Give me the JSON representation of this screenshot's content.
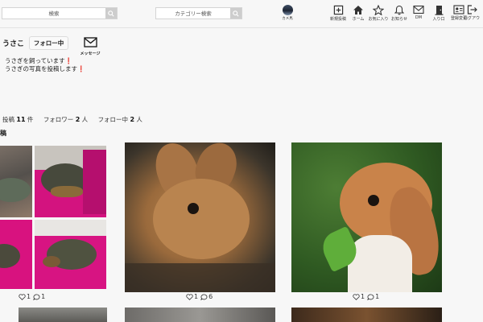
{
  "header": {
    "search_placeholder": "検索",
    "category_placeholder": "カテゴリー検索",
    "logo_text": "カメ馬",
    "nav": [
      {
        "label": "新規投稿",
        "icon": "plus-square-icon"
      },
      {
        "label": "ホーム",
        "icon": "home-icon"
      },
      {
        "label": "お気に入り",
        "icon": "star-icon"
      },
      {
        "label": "お知らせ",
        "icon": "bell-icon"
      },
      {
        "label": "DM",
        "icon": "mail-icon"
      },
      {
        "label": "入り口",
        "icon": "door-icon"
      },
      {
        "label": "登録変更",
        "icon": "id-card-icon"
      },
      {
        "label": "ログアウ",
        "icon": "logout-icon"
      }
    ]
  },
  "profile": {
    "username": "うさこ",
    "follow_label": "フォロー中",
    "message_label": "メッセージ",
    "bio_line1": "うさぎを飼っています",
    "bio_line2": "うさぎの写真を投稿します",
    "bio_mark": "❗"
  },
  "stats": {
    "posts_label": "投稿",
    "posts_count": "11",
    "posts_unit": "件",
    "followers_label": "フォロワー",
    "followers_count": "2",
    "followers_unit": "人",
    "following_label": "フォロー中",
    "following_count": "2",
    "following_unit": "人"
  },
  "section_title": "稿",
  "posts": [
    {
      "likes": "1",
      "comments": "1"
    },
    {
      "likes": "1",
      "comments": "6"
    },
    {
      "likes": "1",
      "comments": "1"
    }
  ],
  "colors": {
    "background": "#f7f7f7",
    "accent_red": "#d40000",
    "search_button": "#cdcdcd"
  }
}
